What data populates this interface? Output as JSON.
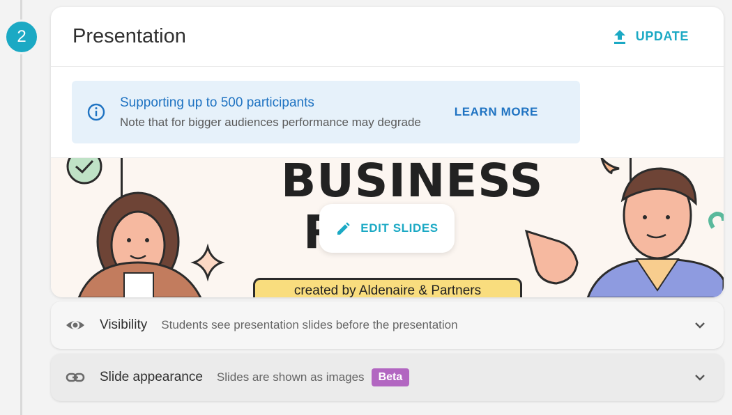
{
  "step": {
    "number": "2"
  },
  "presentation": {
    "title": "Presentation",
    "update_label": "UPDATE",
    "info": {
      "title": "Supporting up to 500 participants",
      "subtitle": "Note that for bigger audiences performance may degrade",
      "learn_more": "LEARN MORE"
    },
    "slide": {
      "title_line1": "BUSINESS",
      "title_line2": "R    T",
      "banner": "created by Aldenaire & Partners",
      "edit_label": "EDIT SLIDES"
    }
  },
  "settings": {
    "visibility": {
      "label": "Visibility",
      "description": "Students see presentation slides before the presentation"
    },
    "appearance": {
      "label": "Slide appearance",
      "description": "Slides are shown as images",
      "badge": "Beta"
    }
  },
  "colors": {
    "accent": "#1ba9c4",
    "info_blue": "#1f73c2",
    "beta": "#b266c1"
  }
}
